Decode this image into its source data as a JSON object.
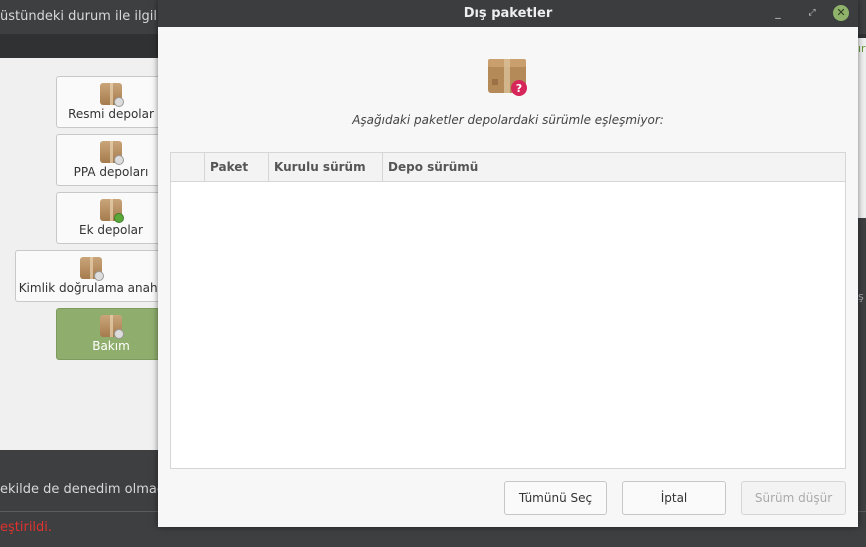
{
  "background": {
    "top_text": "üstündeki durum ile ilgili d",
    "nav_items": [
      {
        "label": "Resmi depolar"
      },
      {
        "label": "PPA depoları"
      },
      {
        "label": "Ek depolar"
      },
      {
        "label": "Kimlik doğrulama anaht"
      },
      {
        "label": "Bakım"
      }
    ],
    "bottom_text": "ekilde de denedim olmadı",
    "error_text": "eştirildi.",
    "right_edge_text": "ırt",
    "right_edge_text2": "ş",
    "accent_color": "#8fae6d",
    "error_color": "#e0322e"
  },
  "dialog": {
    "title": "Dış paketler",
    "message": "Aşağıdaki paketler depolardaki sürümle eşleşmiyor:",
    "icon": "package-question-icon",
    "table": {
      "columns": [
        "",
        "Paket",
        "Kurulu sürüm",
        "Depo sürümü"
      ],
      "rows": []
    },
    "buttons": {
      "select_all": "Tümünü Seç",
      "cancel": "İptal",
      "downgrade": "Sürüm düşür"
    }
  }
}
